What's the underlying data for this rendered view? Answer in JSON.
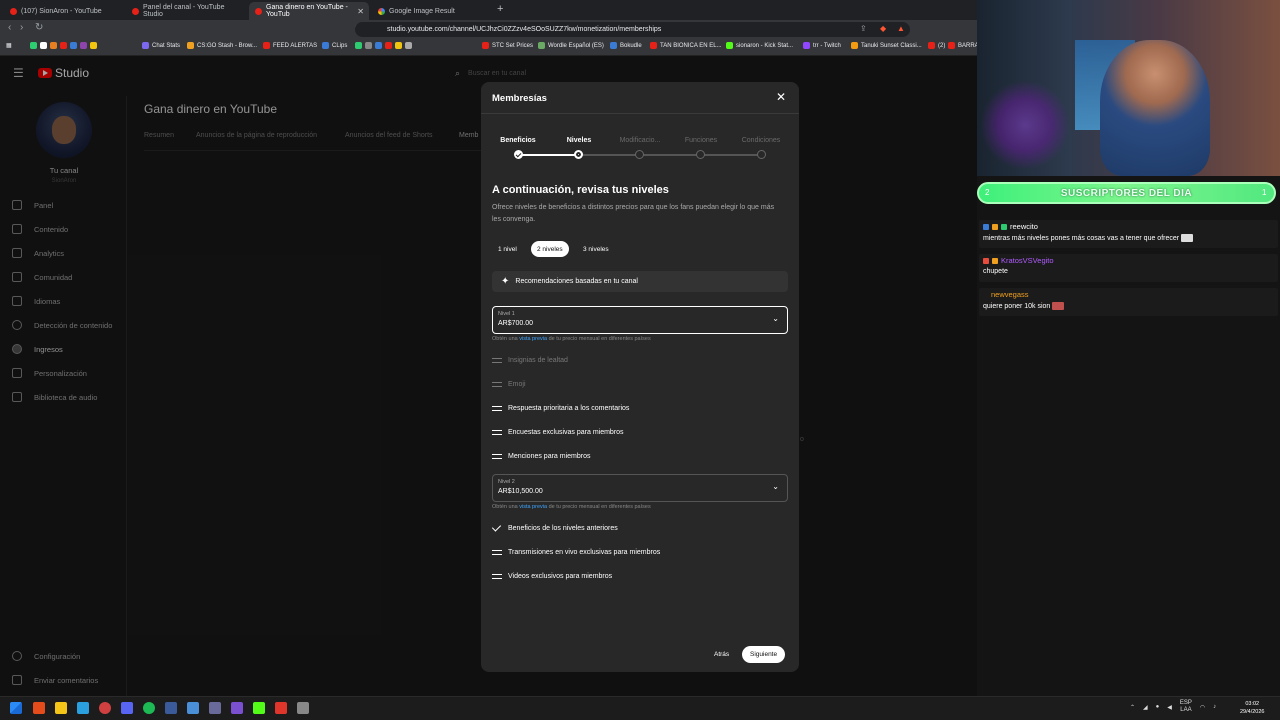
{
  "browser": {
    "tabs": [
      {
        "label": "(107) SionAron - YouTube",
        "active": false,
        "icon": "youtube-icon"
      },
      {
        "label": "Panel del canal - YouTube Studio",
        "active": false,
        "icon": "youtube-icon"
      },
      {
        "label": "Gana dinero en YouTube - YouTub",
        "active": true,
        "icon": "youtube-icon"
      },
      {
        "label": "Google Image Result",
        "active": false,
        "icon": "google-icon"
      }
    ],
    "url": "studio.youtube.com/channel/UCJhzCi0ZZzv4eSOoSUZZ7kw/monetization/memberships",
    "bookmarks": [
      "Chat Stats",
      "CS:GO Stash - Brow...",
      "FEED ALERTAS",
      "CLips",
      "STC Set Prices",
      "Wordle Español (ES)",
      "Bokudle",
      "TAN BIONICA EN EL...",
      "sionaron - Kick Stat...",
      "trr - Twitch",
      "Tanuki Sunset Classi...",
      "(2)",
      "BARRA"
    ]
  },
  "studio": {
    "logo_text": "Studio",
    "search_placeholder": "Buscar en tu canal",
    "channel_name": "Tu canal",
    "channel_sub": "SionAron",
    "sidebar": [
      {
        "label": "Panel",
        "icon": "dashboard-icon"
      },
      {
        "label": "Contenido",
        "icon": "content-icon"
      },
      {
        "label": "Analytics",
        "icon": "analytics-icon"
      },
      {
        "label": "Comunidad",
        "icon": "community-icon"
      },
      {
        "label": "Idiomas",
        "icon": "subtitles-icon"
      },
      {
        "label": "Detección de contenido",
        "icon": "copyright-icon"
      },
      {
        "label": "Ingresos",
        "icon": "monetization-icon"
      },
      {
        "label": "Personalización",
        "icon": "customization-icon"
      },
      {
        "label": "Biblioteca de audio",
        "icon": "audio-library-icon"
      }
    ],
    "sidebar_bottom": [
      {
        "label": "Configuración",
        "icon": "settings-icon"
      },
      {
        "label": "Enviar comentarios",
        "icon": "feedback-icon"
      }
    ],
    "page_title": "Gana dinero en YouTube",
    "page_tabs": [
      "Resumen",
      "Anuncios de la página de reproducción",
      "Anuncios del feed de Shorts",
      "Memb"
    ]
  },
  "modal": {
    "title": "Membresías",
    "steps": [
      {
        "label": "Beneficios",
        "state": "done"
      },
      {
        "label": "Niveles",
        "state": "current"
      },
      {
        "label": "Modificacio...",
        "state": "todo"
      },
      {
        "label": "Funciones",
        "state": "todo"
      },
      {
        "label": "Condiciones",
        "state": "todo"
      }
    ],
    "heading": "A continuación, revisa tus niveles",
    "description": "Ofrece niveles de beneficios a distintos precios para que los fans puedan elegir lo que más les convenga.",
    "level_chips": [
      {
        "label": "1 nivel",
        "selected": false
      },
      {
        "label": "2 niveles",
        "selected": true
      },
      {
        "label": "3 niveles",
        "selected": false
      }
    ],
    "recommendation": "Recomendaciones basadas en tu canal",
    "hint_prefix": "Obtén una",
    "hint_link": "vista previa",
    "hint_suffix": "de tu precio mensual en diferentes países",
    "tier1": {
      "label": "Nivel 1",
      "value": "AR$700.00",
      "perks": [
        {
          "label": "Insignias de lealtad",
          "dim": true,
          "icon": "drag-handle-icon"
        },
        {
          "label": "Emoji",
          "dim": true,
          "icon": "drag-handle-icon"
        },
        {
          "label": "Respuesta prioritaria a los comentarios",
          "dim": false,
          "icon": "drag-handle-icon"
        },
        {
          "label": "Encuestas exclusivas para miembros",
          "dim": false,
          "icon": "drag-handle-icon"
        },
        {
          "label": "Menciones para miembros",
          "dim": false,
          "icon": "drag-handle-icon"
        }
      ]
    },
    "tier2": {
      "label": "Nivel 2",
      "value": "AR$10,500.00",
      "perks": [
        {
          "label": "Beneficios de los niveles anteriores",
          "dim": false,
          "icon": "check-icon"
        },
        {
          "label": "Transmisiones en vivo exclusivas para miembros",
          "dim": false,
          "icon": "drag-handle-icon"
        },
        {
          "label": "Videos exclusivos para miembros",
          "dim": false,
          "icon": "drag-handle-icon"
        }
      ]
    },
    "back_label": "Atrás",
    "next_label": "Siguiente"
  },
  "stream": {
    "subs_banner": "SUSCRIPTORES DEL DIA",
    "subs_left": "2",
    "subs_right": "1",
    "chat": [
      {
        "user": "reewcito",
        "user_color": "#ffffff",
        "message": "mientras más niveles pones más cosas vas a tener que ofrecer"
      },
      {
        "user": "KratosVSVegito",
        "user_color": "#b05cff",
        "message": "chupete"
      },
      {
        "user": "newvegass",
        "user_color": "#f0a020",
        "message": "quiere poner 10k sion"
      }
    ]
  },
  "taskbar": {
    "lang": "ESP",
    "lang_sub": "LAA",
    "time": "03:02",
    "date": "29/4/2026"
  },
  "colors": {
    "accent_link": "#3ea6ff",
    "youtube_red": "#ff0000",
    "subs_green": "#3ef07a"
  }
}
